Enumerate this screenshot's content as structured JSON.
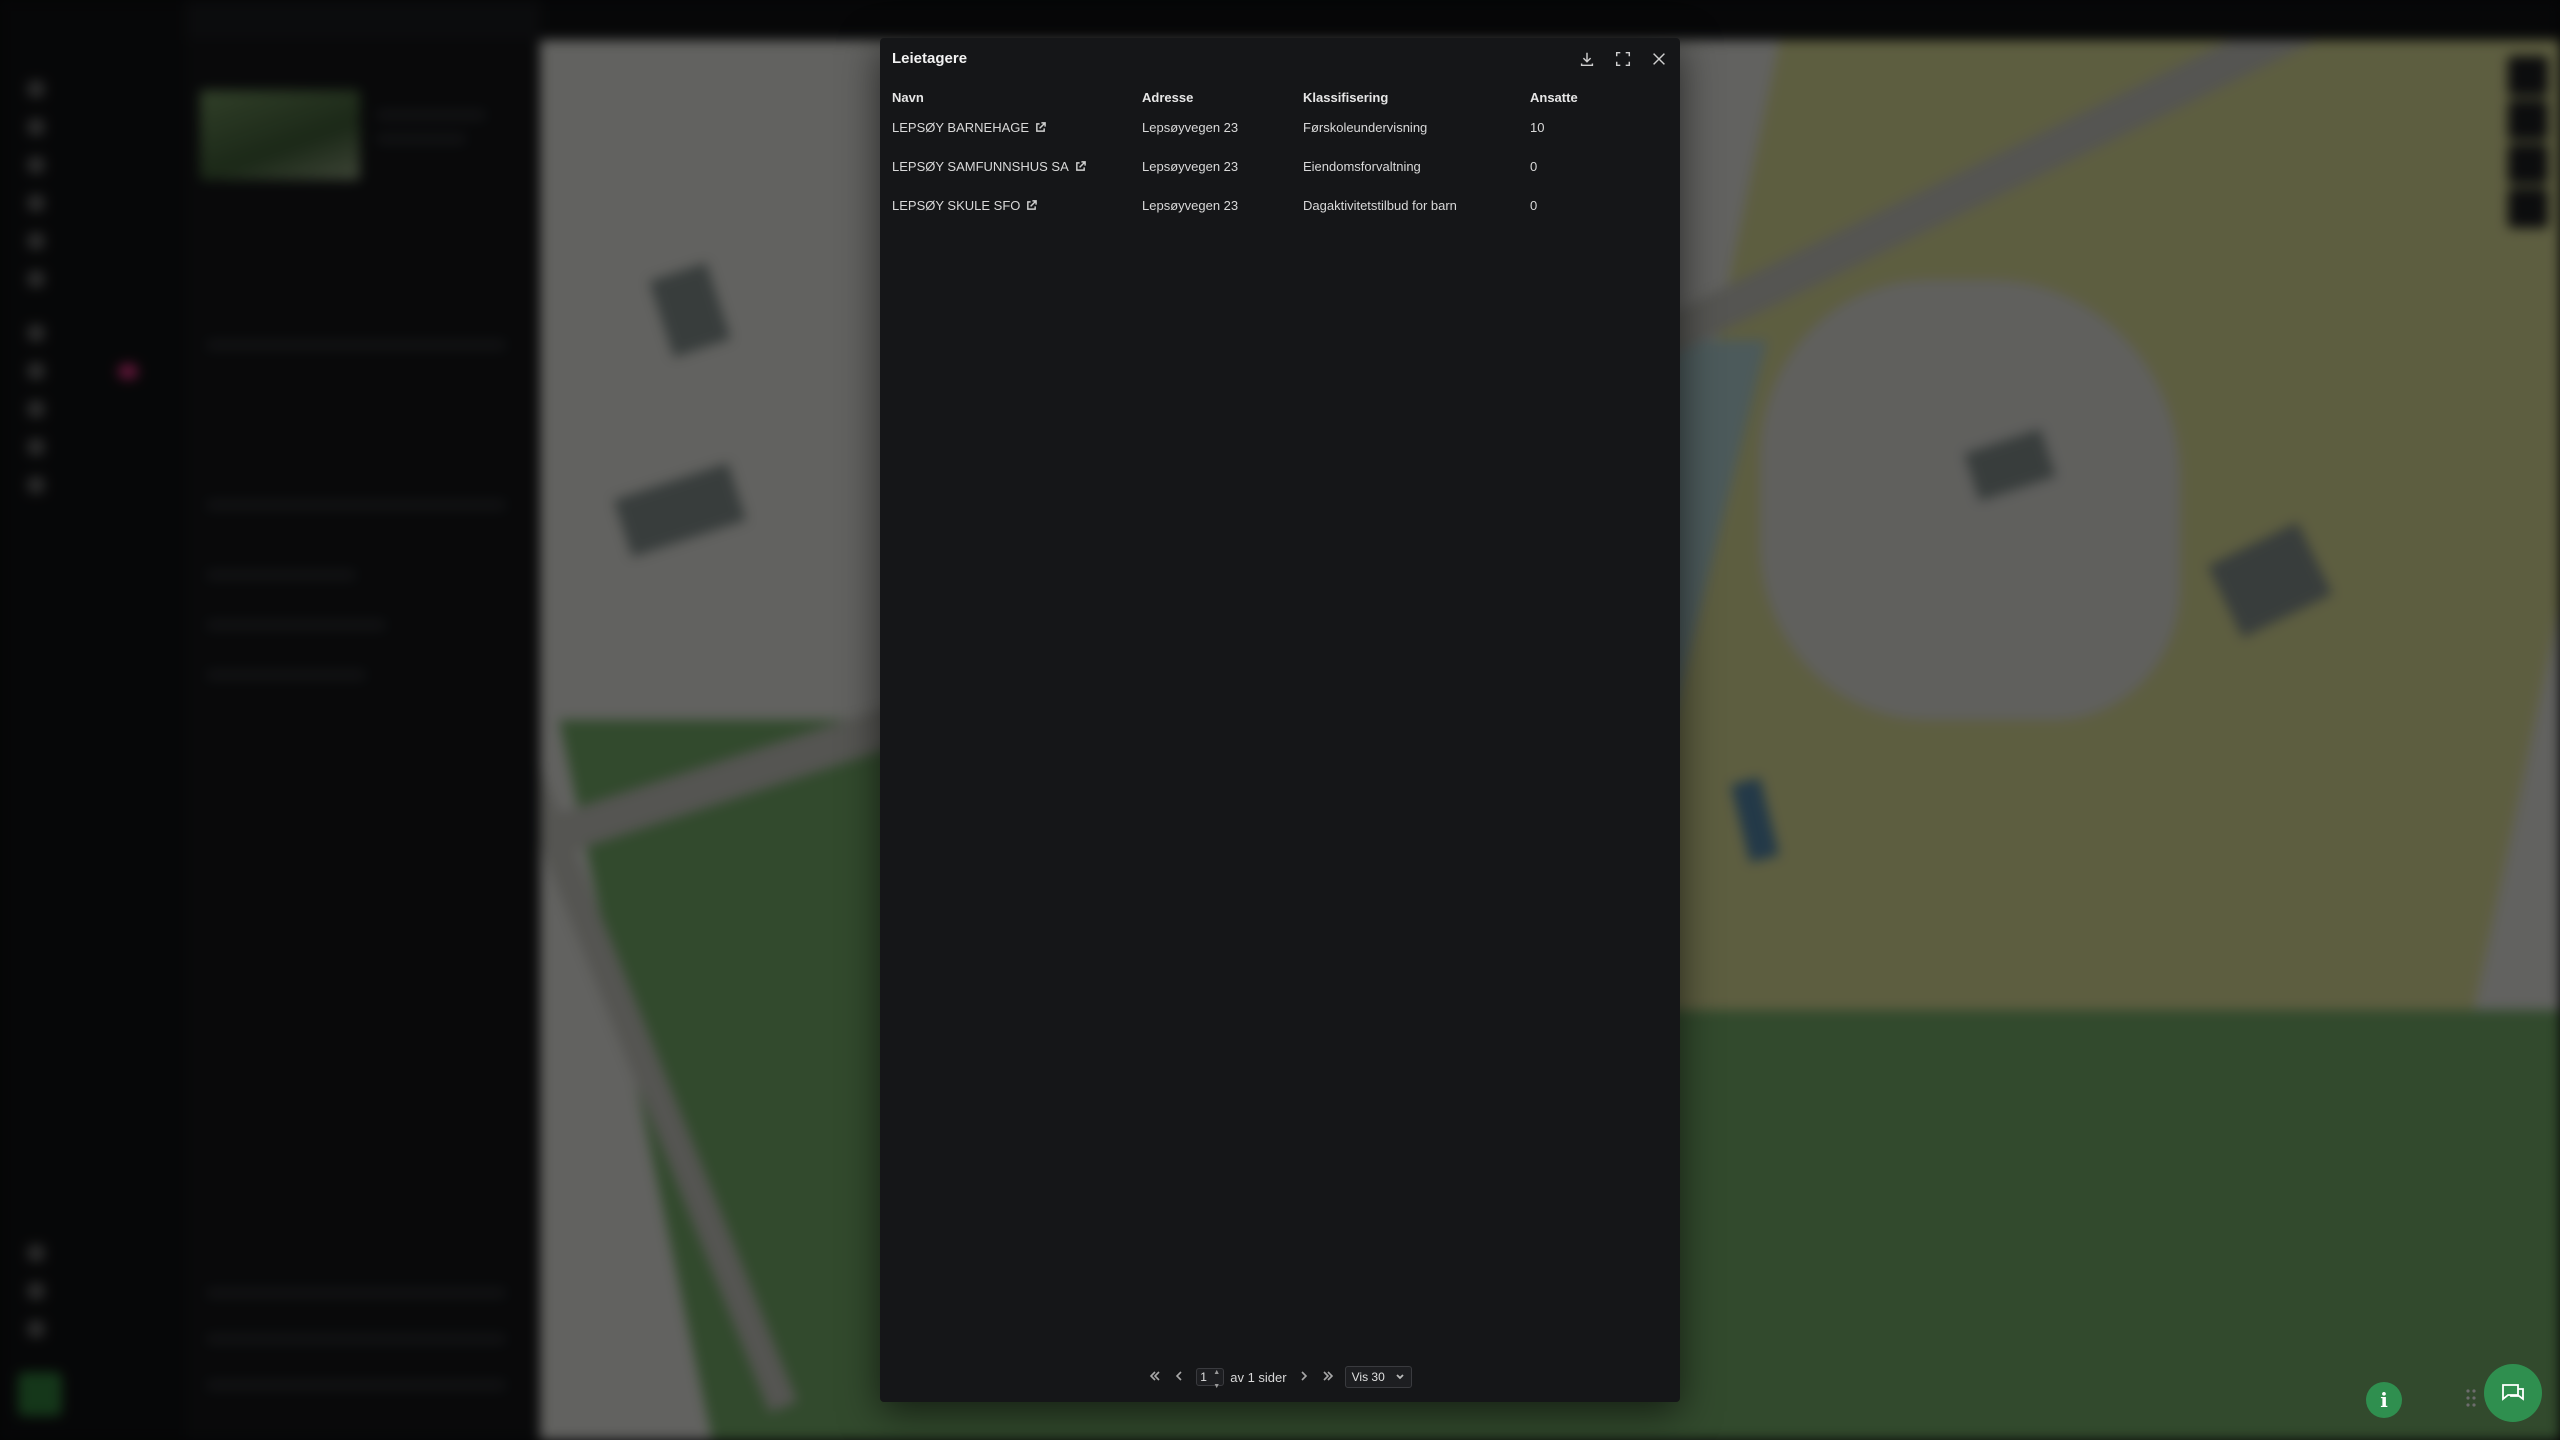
{
  "modal": {
    "title": "Leietagere",
    "columns": [
      "Navn",
      "Adresse",
      "Klassifisering",
      "Ansatte"
    ],
    "rows": [
      {
        "name": "LEPSØY BARNEHAGE",
        "address": "Lepsøyvegen 23",
        "classification": "Førskoleundervisning",
        "employees": "10"
      },
      {
        "name": "LEPSØY SAMFUNNSHUS SA",
        "address": "Lepsøyvegen 23",
        "classification": "Eiendomsforvaltning",
        "employees": "0"
      },
      {
        "name": "LEPSØY SKULE SFO",
        "address": "Lepsøyvegen 23",
        "classification": "Dagaktivitetstilbud for barn",
        "employees": "0"
      }
    ],
    "pagination": {
      "current_page": "1",
      "total_label": "av 1 sider",
      "per_page": "Vis 30"
    }
  },
  "icons": {
    "download": "download-icon",
    "fullscreen": "expand-icon",
    "close": "close-icon",
    "external": "external-link-icon",
    "info": "i",
    "chat": "chat-icon"
  },
  "colors": {
    "modal_bg": "#151618",
    "accent": "#2f8f4f",
    "badge": "#d6337e"
  }
}
